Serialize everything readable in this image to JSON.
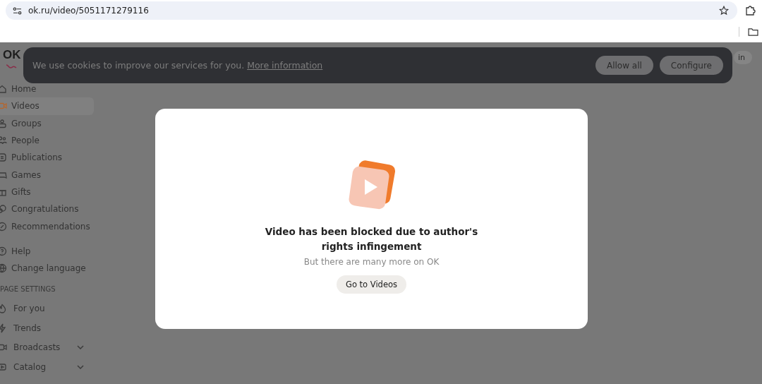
{
  "browser": {
    "url": "ok.ru/video/5051171279116"
  },
  "logo": {
    "text": "OK"
  },
  "header": {
    "login_button": "in"
  },
  "sidebar": {
    "items": [
      {
        "label": "Home",
        "selected": false
      },
      {
        "label": "Videos",
        "selected": true
      },
      {
        "label": "Groups",
        "selected": false
      },
      {
        "label": "People",
        "selected": false
      },
      {
        "label": "Publications",
        "selected": false
      },
      {
        "label": "Games",
        "selected": false
      },
      {
        "label": "Gifts",
        "selected": false
      },
      {
        "label": "Congratulations",
        "selected": false
      },
      {
        "label": "Recommendations",
        "selected": false
      }
    ],
    "extra_items": [
      {
        "label": "Help"
      },
      {
        "label": "Change language"
      }
    ],
    "section_title": "PAGE SETTINGS",
    "settings_items": [
      {
        "label": "For you",
        "expandable": false
      },
      {
        "label": "Trends",
        "expandable": false
      },
      {
        "label": "Broadcasts",
        "expandable": true
      },
      {
        "label": "Catalog",
        "expandable": true
      }
    ]
  },
  "cookie_banner": {
    "text": "We use cookies to improve our services for you.",
    "link": "More information",
    "buttons": [
      "Allow all",
      "Configure"
    ]
  },
  "modal": {
    "title": "Video has been blocked due to author's rights infingement",
    "subtitle": "But there are many more on OK",
    "button": "Go to Videos"
  }
}
